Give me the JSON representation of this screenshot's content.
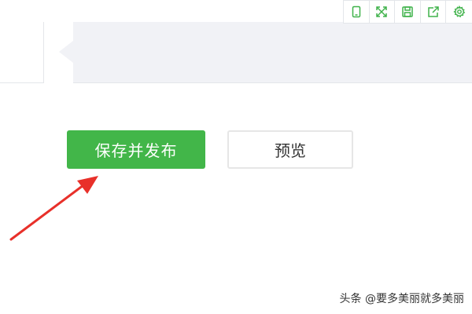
{
  "toolbar": {
    "items": [
      {
        "icon": "mobile-preview-icon"
      },
      {
        "icon": "fullscreen-icon"
      },
      {
        "icon": "save-icon"
      },
      {
        "icon": "share-icon"
      },
      {
        "icon": "settings-icon"
      }
    ],
    "icon_color": "#3fb24a"
  },
  "actions": {
    "publish_label": "保存并发布",
    "preview_label": "预览"
  },
  "colors": {
    "publish_bg": "#42b649",
    "arrow": "#e8302a",
    "editor_bg": "#f1f2f6"
  },
  "watermark": {
    "text": "头条 @要多美丽就多美丽"
  }
}
